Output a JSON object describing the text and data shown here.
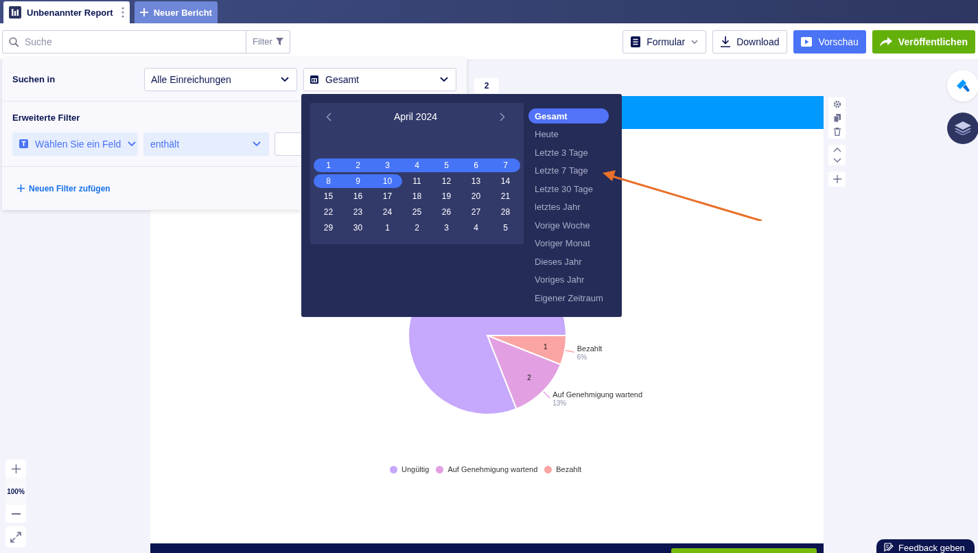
{
  "tabs": [
    {
      "label": "Unbenannter Report",
      "kind": "report",
      "selected": true
    },
    {
      "label": "Neuer Bericht",
      "kind": "new",
      "selected": false
    }
  ],
  "search": {
    "placeholder": "Suche"
  },
  "filter_button": {
    "label": "Filter"
  },
  "toolbar_buttons": [
    {
      "label": "Formular",
      "kind": "form"
    },
    {
      "label": "Download",
      "kind": "download"
    },
    {
      "label": "Vorschau",
      "kind": "preview"
    },
    {
      "label": "Veröffentlichen",
      "kind": "publish"
    }
  ],
  "filter_panel": {
    "search_in_label": "Suchen in",
    "scope": "Alle Einreichungen",
    "period": "Gesamt",
    "advanced_label": "Erweiterte Filter",
    "field": "Wählen Sie ein Feld",
    "operator": "enthält",
    "add_filter": "Neuen Filter zufügen"
  },
  "page_badge": "2",
  "date_picker": {
    "month": "April 2024",
    "weeks": [
      [
        {
          "day": "1",
          "in_range": true
        },
        {
          "day": "2",
          "in_range": true
        },
        {
          "day": "3",
          "in_range": true
        },
        {
          "day": "4",
          "in_range": true
        },
        {
          "day": "5",
          "in_range": true
        },
        {
          "day": "6",
          "in_range": true
        },
        {
          "day": "7",
          "in_range": true
        }
      ],
      [
        {
          "day": "8",
          "in_range": true
        },
        {
          "day": "9",
          "in_range": true
        },
        {
          "day": "10",
          "in_range": true
        },
        {
          "day": "11",
          "in_range": false
        },
        {
          "day": "12",
          "in_range": false
        },
        {
          "day": "13",
          "in_range": false
        },
        {
          "day": "14",
          "in_range": false
        }
      ],
      [
        {
          "day": "15",
          "in_range": false
        },
        {
          "day": "16",
          "in_range": false
        },
        {
          "day": "17",
          "in_range": false
        },
        {
          "day": "18",
          "in_range": false
        },
        {
          "day": "19",
          "in_range": false
        },
        {
          "day": "20",
          "in_range": false
        },
        {
          "day": "21",
          "in_range": false
        }
      ],
      [
        {
          "day": "22",
          "in_range": false
        },
        {
          "day": "23",
          "in_range": false
        },
        {
          "day": "24",
          "in_range": false
        },
        {
          "day": "25",
          "in_range": false
        },
        {
          "day": "26",
          "in_range": false
        },
        {
          "day": "27",
          "in_range": false
        },
        {
          "day": "28",
          "in_range": false
        }
      ],
      [
        {
          "day": "29",
          "in_range": false
        },
        {
          "day": "30",
          "in_range": false
        },
        {
          "day": "1",
          "in_range": false
        },
        {
          "day": "2",
          "in_range": false
        },
        {
          "day": "3",
          "in_range": false
        },
        {
          "day": "4",
          "in_range": false
        },
        {
          "day": "5",
          "in_range": false
        }
      ]
    ],
    "presets": [
      {
        "label": "Gesamt",
        "selected": true
      },
      {
        "label": "Heute",
        "selected": false
      },
      {
        "label": "Letzte 3 Tage",
        "selected": false
      },
      {
        "label": "Letzte 7 Tage",
        "selected": false
      },
      {
        "label": "Letzte 30 Tage",
        "selected": false
      },
      {
        "label": "letztes Jahr",
        "selected": false
      },
      {
        "label": "Vorige Woche",
        "selected": false
      },
      {
        "label": "Voriger Monat",
        "selected": false
      },
      {
        "label": "Dieses Jahr",
        "selected": false
      },
      {
        "label": "Voriges Jahr",
        "selected": false
      },
      {
        "label": "Eigener Zeitraum",
        "selected": false
      }
    ]
  },
  "report": {
    "chart_data": {
      "type": "pie",
      "categories": [
        "Ungültig",
        "Auf Genehmigung wartend",
        "Bezahlt"
      ],
      "series": [
        {
          "colors": [
            "#c6a8fc",
            "#e2a0e2",
            "#fba4a4"
          ],
          "values": [
            81,
            13,
            6
          ]
        }
      ],
      "value_labels": [
        null,
        "2",
        "1"
      ],
      "annotations": [
        null,
        {
          "text": "13%"
        },
        {
          "text": "6%"
        }
      ]
    }
  },
  "zoom": {
    "level": "100%"
  },
  "feedback": {
    "label": "Feedback geben"
  }
}
